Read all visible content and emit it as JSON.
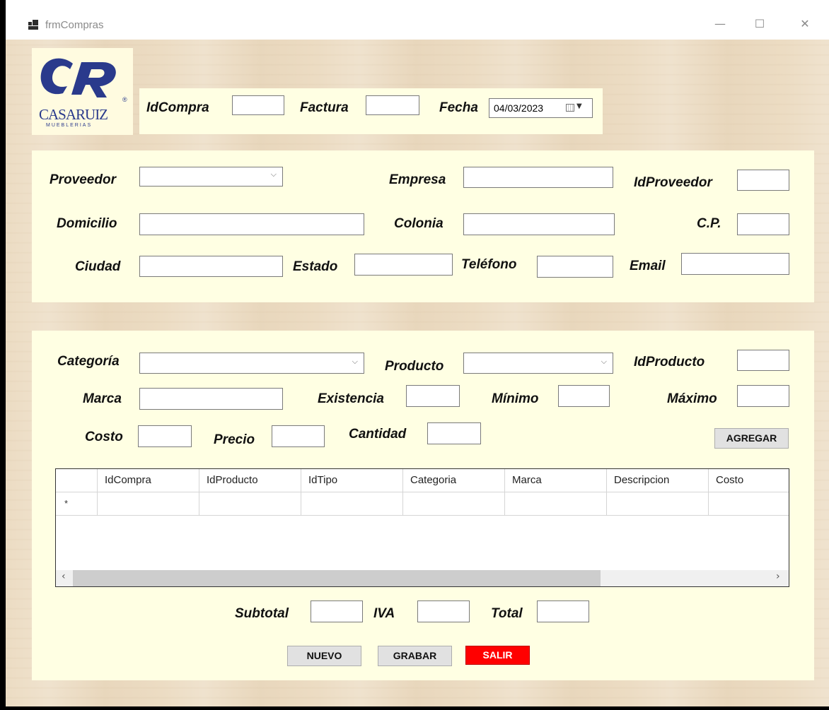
{
  "window": {
    "title": "frmCompras",
    "minimize": "—",
    "maximize": "☐",
    "close": "✕"
  },
  "logo": {
    "mark": "CR",
    "brand": "CASARUIZ",
    "sub": "MUEBLERIAS",
    "reg": "®",
    "brand_color": "#2a3a8c"
  },
  "header": {
    "idcompra_label": "IdCompra",
    "idcompra_value": "",
    "factura_label": "Factura",
    "factura_value": "",
    "fecha_label": "Fecha",
    "fecha_value": "04/03/2023"
  },
  "proveedor": {
    "proveedor_label": "Proveedor",
    "proveedor_value": "",
    "empresa_label": "Empresa",
    "empresa_value": "",
    "idproveedor_label": "IdProveedor",
    "idproveedor_value": "",
    "domicilio_label": "Domicilio",
    "domicilio_value": "",
    "colonia_label": "Colonia",
    "colonia_value": "",
    "cp_label": "C.P.",
    "cp_value": "",
    "ciudad_label": "Ciudad",
    "ciudad_value": "",
    "estado_label": "Estado",
    "estado_value": "",
    "telefono_label": "Teléfono",
    "telefono_value": "",
    "email_label": "Email",
    "email_value": ""
  },
  "producto": {
    "categoria_label": "Categoría",
    "categoria_value": "",
    "producto_label": "Producto",
    "producto_value": "",
    "idproducto_label": "IdProducto",
    "idproducto_value": "",
    "marca_label": "Marca",
    "marca_value": "",
    "existencia_label": "Existencia",
    "existencia_value": "",
    "minimo_label": "Mínimo",
    "minimo_value": "",
    "maximo_label": "Máximo",
    "maximo_value": "",
    "costo_label": "Costo",
    "costo_value": "",
    "precio_label": "Precio",
    "precio_value": "",
    "cantidad_label": "Cantidad",
    "cantidad_value": "",
    "agregar_label": "AGREGAR"
  },
  "grid": {
    "columns": [
      "IdCompra",
      "IdProducto",
      "IdTipo",
      "Categoria",
      "Marca",
      "Descripcion",
      "Costo"
    ],
    "new_row_marker": "*"
  },
  "totals": {
    "subtotal_label": "Subtotal",
    "subtotal_value": "",
    "iva_label": "IVA",
    "iva_value": "",
    "total_label": "Total",
    "total_value": ""
  },
  "actions": {
    "nuevo": "NUEVO",
    "grabar": "GRABAR",
    "salir": "SALIR",
    "salir_color": "#ff0000"
  }
}
